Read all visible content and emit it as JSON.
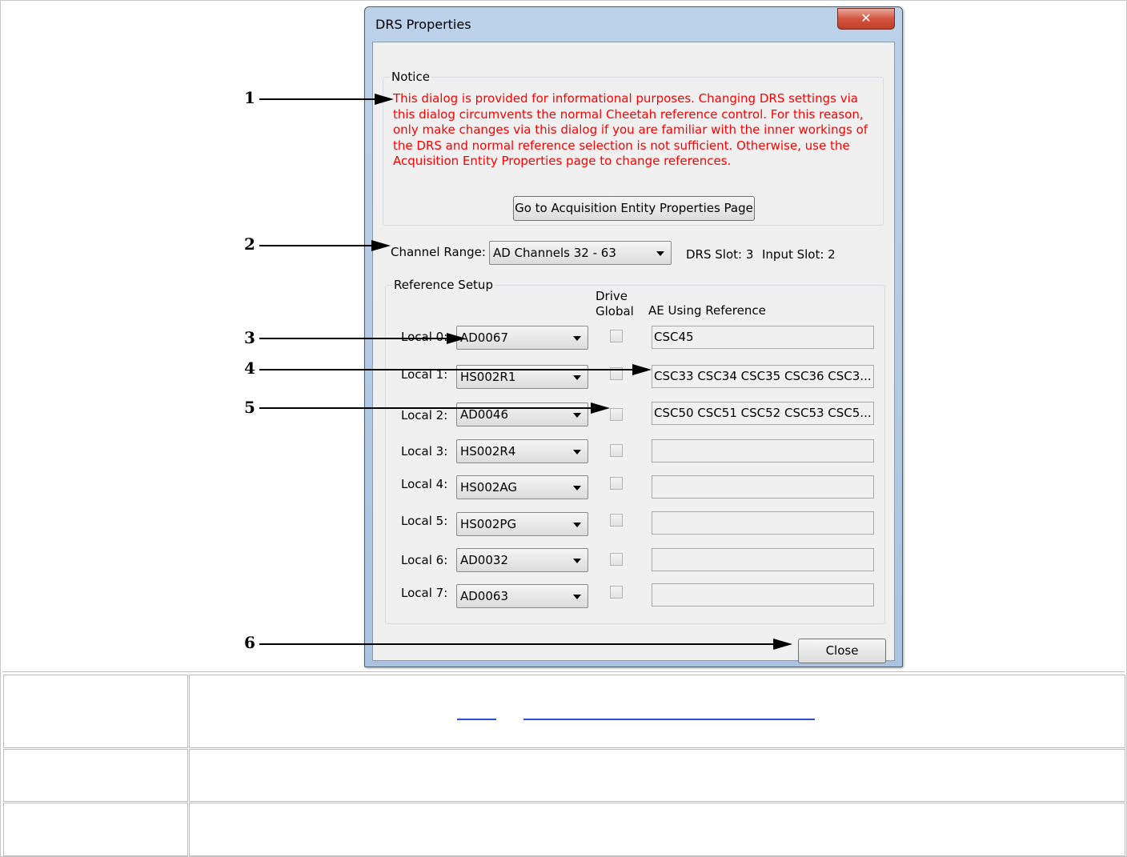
{
  "dialog": {
    "title": "DRS Properties",
    "close_glyph": "✕",
    "notice": {
      "label": "Notice",
      "text": "This dialog is provided for informational purposes.  Changing DRS settings via this dialog circumvents the normal Cheetah reference control.  For this reason, only make changes via this dialog if you are familiar with the inner workings of the DRS and normal reference selection is not sufficient.  Otherwise, use the Acquisition Entity Properties page to change references.",
      "text_color": "#ff0000",
      "button_label": "Go to Acquisition Entity Properties Page"
    },
    "channel_range": {
      "label": "Channel Range:",
      "value": "AD Channels 32 - 63",
      "drs_slot": "DRS Slot: 3",
      "input_slot": "Input Slot: 2"
    },
    "reference_setup": {
      "label": "Reference Setup",
      "col_drive_global_1": "Drive",
      "col_drive_global_2": "Global",
      "col_ae_using": "AE Using Reference",
      "rows": [
        {
          "label": "Local 0:",
          "reference": "AD0067",
          "drive_global": false,
          "ae": "CSC45"
        },
        {
          "label": "Local 1:",
          "reference": "HS002R1",
          "drive_global": false,
          "ae": "CSC33 CSC34 CSC35 CSC36 CSC3..."
        },
        {
          "label": "Local 2:",
          "reference": "AD0046",
          "drive_global": false,
          "ae": "CSC50 CSC51 CSC52 CSC53 CSC5..."
        },
        {
          "label": "Local 3:",
          "reference": "HS002R4",
          "drive_global": false,
          "ae": ""
        },
        {
          "label": "Local 4:",
          "reference": "HS002AG",
          "drive_global": false,
          "ae": ""
        },
        {
          "label": "Local 5:",
          "reference": "HS002PG",
          "drive_global": false,
          "ae": ""
        },
        {
          "label": "Local 6:",
          "reference": "AD0032",
          "drive_global": false,
          "ae": ""
        },
        {
          "label": "Local 7:",
          "reference": "AD0063",
          "drive_global": false,
          "ae": ""
        }
      ]
    },
    "close_button_label": "Close"
  },
  "callouts": [
    "1",
    "2",
    "3",
    "4",
    "5",
    "6"
  ],
  "icons": {
    "dropdown": "chevron-down-icon",
    "close": "close-icon",
    "arrow": "arrow-right-icon"
  },
  "colors": {
    "titlebar": "#bcd2ea",
    "close_button": "#d2553f",
    "link_underline": "#2b50d8"
  }
}
